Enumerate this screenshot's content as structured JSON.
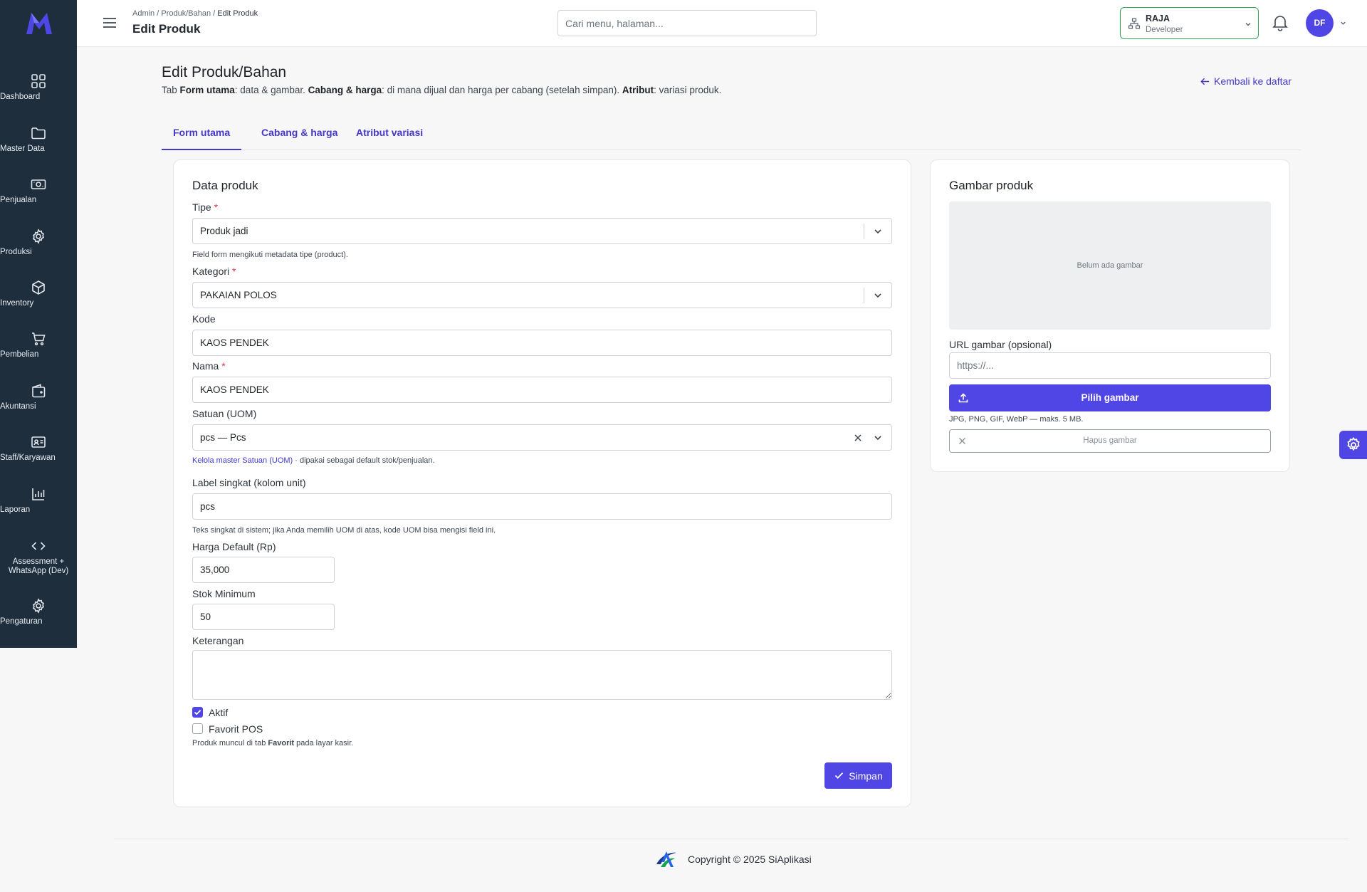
{
  "sidebar": {
    "items": [
      {
        "label": "Dashboard",
        "icon": "grid-icon"
      },
      {
        "label": "Master Data",
        "icon": "folder-icon"
      },
      {
        "label": "Penjualan",
        "icon": "cash-icon"
      },
      {
        "label": "Produksi",
        "icon": "gear-icon"
      },
      {
        "label": "Inventory",
        "icon": "box-icon"
      },
      {
        "label": "Pembelian",
        "icon": "cart-icon"
      },
      {
        "label": "Akuntansi",
        "icon": "wallet-icon"
      },
      {
        "label": "Staff/Karyawan",
        "icon": "id-card-icon"
      },
      {
        "label": "Laporan",
        "icon": "bar-chart-icon"
      },
      {
        "label": "Assessment + WhatsApp (Dev)",
        "icon": "code-icon"
      },
      {
        "label": "Pengaturan",
        "icon": "gear-icon"
      }
    ]
  },
  "header": {
    "breadcrumb": {
      "admin": "Admin",
      "sep": " / ",
      "section": "Produk/Bahan",
      "current": "Edit Produk"
    },
    "title": "Edit Produk",
    "search_placeholder": "Cari menu, halaman...",
    "branch": {
      "name": "RAJA",
      "role": "Developer"
    },
    "avatar_initials": "DF"
  },
  "page": {
    "title": "Edit Produk/Bahan",
    "desc": {
      "p1": "Tab ",
      "b1": "Form utama",
      "p2": ": data & gambar. ",
      "b2": "Cabang & harga",
      "p3": ": di mana dijual dan harga per cabang (setelah simpan). ",
      "b3": "Atribut",
      "p4": ": variasi produk."
    },
    "back_label": "Kembali ke daftar",
    "tabs": [
      {
        "label": "Form utama",
        "active": true
      },
      {
        "label": "Cabang & harga",
        "active": false
      },
      {
        "label": "Atribut variasi",
        "active": false
      }
    ]
  },
  "form": {
    "card_title": "Data produk",
    "tipe": {
      "label": "Tipe",
      "required": "*",
      "value": "Produk jadi",
      "hint": "Field form mengikuti metadata tipe (product)."
    },
    "kategori": {
      "label": "Kategori",
      "required": "*",
      "value": "PAKAIAN POLOS"
    },
    "kode": {
      "label": "Kode",
      "value": "KAOS PENDEK"
    },
    "nama": {
      "label": "Nama",
      "required": "*",
      "value": "KAOS PENDEK"
    },
    "satuan": {
      "label": "Satuan (UOM)",
      "value": "pcs — Pcs",
      "hint_link": "Kelola master Satuan (UOM)",
      "hint_text": " · dipakai sebagai default stok/penjualan."
    },
    "label_singkat": {
      "label": "Label singkat (kolom unit)",
      "value": "pcs",
      "hint": "Teks singkat di sistem; jika Anda memilih UOM di atas, kode UOM bisa mengisi field ini."
    },
    "harga": {
      "label": "Harga Default (Rp)",
      "value": "35,000"
    },
    "stok_min": {
      "label": "Stok Minimum",
      "value": "50"
    },
    "keterangan": {
      "label": "Keterangan",
      "value": ""
    },
    "aktif": {
      "label": "Aktif",
      "checked": true
    },
    "favorit": {
      "label": "Favorit POS",
      "checked": false,
      "hint_pre": "Produk muncul di tab ",
      "hint_bold": "Favorit",
      "hint_post": " pada layar kasir."
    },
    "save_label": "Simpan"
  },
  "image_card": {
    "title": "Gambar produk",
    "placeholder_text": "Belum ada gambar",
    "url_label": "URL gambar (opsional)",
    "url_placeholder": "https://...",
    "pick_label": "Pilih gambar",
    "formats_hint": "JPG, PNG, GIF, WebP — maks. 5 MB.",
    "delete_label": "Hapus gambar"
  },
  "footer": {
    "copyright": "Copyright © 2025 SiAplikasi"
  },
  "colors": {
    "primary": "#4f46e5",
    "sidebar_bg": "#1e2e3c",
    "branch_border": "#35a35a",
    "required": "#dc3545"
  }
}
